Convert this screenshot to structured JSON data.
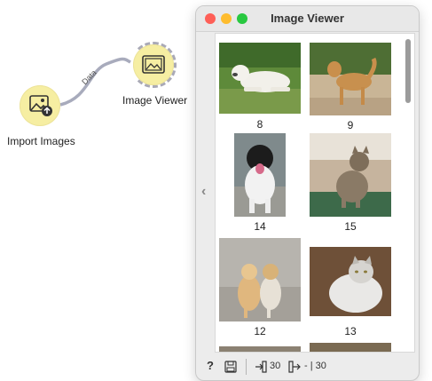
{
  "canvas": {
    "import_widget": {
      "label": "Import Images",
      "icon": "import-images-icon"
    },
    "viewer_widget": {
      "label": "Image Viewer",
      "icon": "image-viewer-icon"
    },
    "link": {
      "label": "Data"
    }
  },
  "window": {
    "title": "Image Viewer",
    "traffic_lights": {
      "close": "#fe5f57",
      "minimize": "#febc2e",
      "zoom": "#28c840"
    },
    "thumbnails": [
      {
        "label": "8",
        "subject": "white dog on grass"
      },
      {
        "label": "9",
        "subject": "tan dog standing"
      },
      {
        "label": "14",
        "subject": "black and white dog sitting"
      },
      {
        "label": "15",
        "subject": "tabby cat sitting"
      },
      {
        "label": "12",
        "subject": "two cats"
      },
      {
        "label": "13",
        "subject": "white and grey cat"
      }
    ],
    "statusbar": {
      "help_icon": "help-icon",
      "save_icon": "save-icon",
      "input_count": "30",
      "output_text": "- | 30"
    }
  },
  "colors": {
    "widget_fill": "#f6eea2",
    "link_color": "#a8abbc",
    "accent": "#6e6e7a"
  }
}
